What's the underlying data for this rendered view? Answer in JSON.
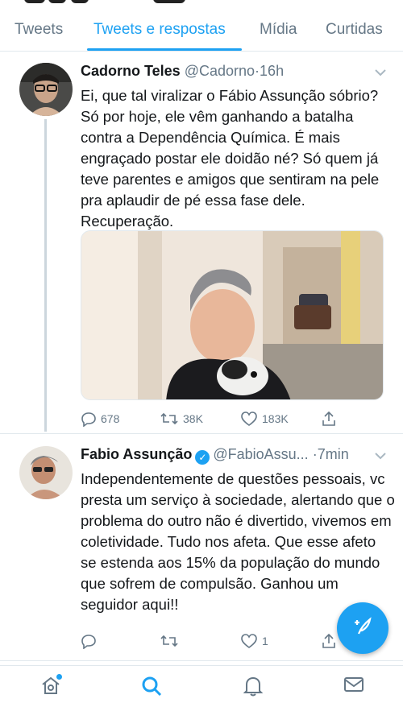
{
  "tabs": [
    {
      "label": "Tweets",
      "active": false
    },
    {
      "label": "Tweets e respostas",
      "active": true
    },
    {
      "label": "Mídia",
      "active": false
    },
    {
      "label": "Curtidas",
      "active": false
    }
  ],
  "tweets": [
    {
      "name": "Cadorno Teles",
      "handle": "@Cadorno",
      "dot": "·",
      "time": "16h",
      "text": "Ei, que tal viralizar o Fábio Assunção sóbrio? Só por hoje, ele vêm ganhando a batalha contra a Dependência Química. É mais engraçado postar ele doidão né? Só quem já teve parentes e amigos que sentiram na pele pra aplaudir de pé essa fase dele. Recuperação.",
      "replies": "678",
      "retweets": "38K",
      "likes": "183K"
    },
    {
      "name": "Fabio Assunção",
      "verified": true,
      "handle": "@FabioAssu...",
      "dot": "·",
      "time": "7min",
      "text": "Independentemente de questões pessoais, vc presta um serviço à sociedade, alertando que o problema do outro não é divertido, vivemos em coletividade. Tudo nos afeta. Que esse afeto se estenda aos 15% da população do mundo que sofrem de compulsão. Ganhou um seguidor aqui!!",
      "replies": "",
      "retweets": "",
      "likes": "1"
    }
  ],
  "icons": {
    "reply": "reply-icon",
    "retweet": "retweet-icon",
    "like": "heart-icon",
    "share": "share-icon",
    "compose": "compose-icon",
    "nav": [
      "home-icon",
      "search-icon",
      "bell-icon",
      "mail-icon"
    ]
  },
  "colors": {
    "accent": "#1da1f2",
    "muted": "#657786",
    "text": "#14171a"
  }
}
